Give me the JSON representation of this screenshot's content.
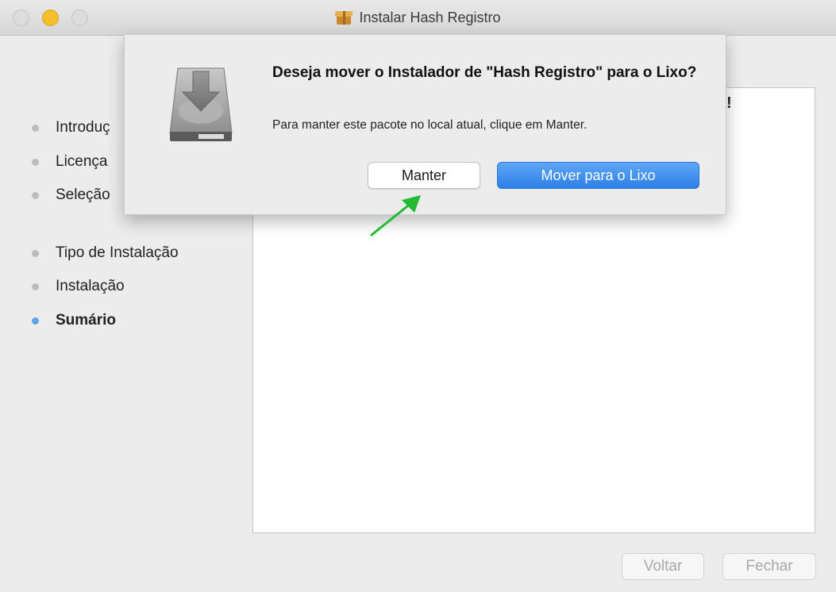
{
  "window": {
    "title": "Instalar Hash Registro"
  },
  "sidebar": {
    "steps": [
      {
        "label": "Introdução",
        "visible_text": "Introduç",
        "active": false
      },
      {
        "label": "Licença",
        "visible_text": "Licença",
        "active": false
      },
      {
        "label": "Seleção",
        "visible_text": "Seleção",
        "active": false
      },
      {
        "label": "Tipo de Instalação",
        "visible_text": "Tipo de Instalação",
        "active": false
      },
      {
        "label": "Instalação",
        "visible_text": "Instalação",
        "active": false
      },
      {
        "label": "Sumário",
        "visible_text": "Sumário",
        "active": true
      }
    ]
  },
  "content": {
    "partial_text": "!"
  },
  "dialog": {
    "title": "Deseja mover o Instalador de \"Hash Registro\" para o Lixo?",
    "message": "Para manter este pacote no local atual, clique em Manter.",
    "keep_label": "Manter",
    "trash_label": "Mover para o Lixo",
    "icon": "installer-disk-icon"
  },
  "footer": {
    "back_label": "Voltar",
    "close_label": "Fechar"
  },
  "colors": {
    "accent": "#3b8ef0",
    "active_dot": "#5ba4ea",
    "annotation_arrow": "#22bb33"
  }
}
